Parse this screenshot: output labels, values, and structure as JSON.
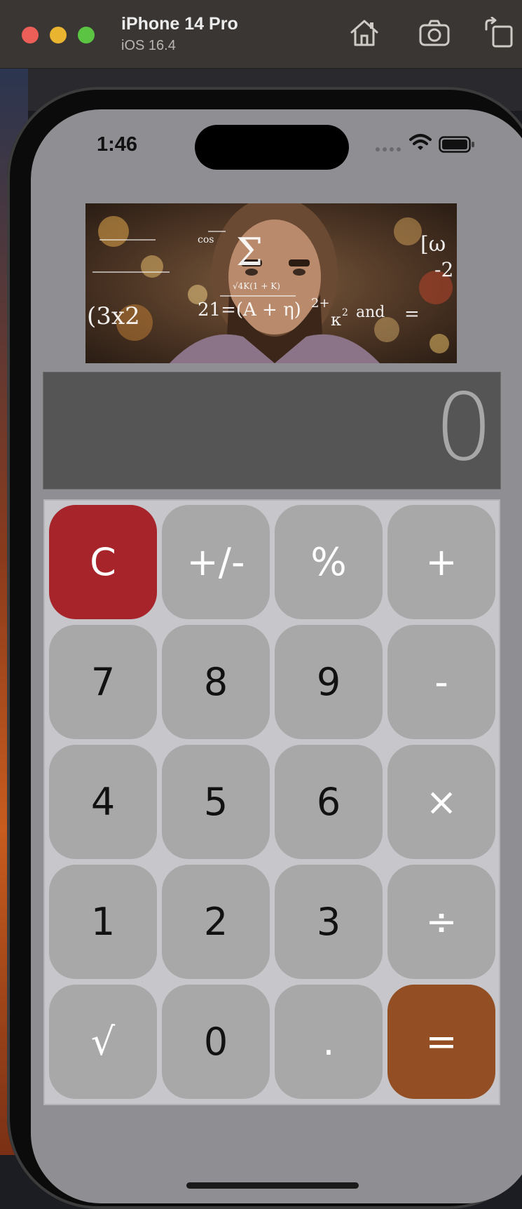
{
  "simulator": {
    "device_name": "iPhone 14 Pro",
    "os_version": "iOS 16.4",
    "icons": [
      "home-icon",
      "screenshot-camera-icon",
      "rotate-icon"
    ]
  },
  "status_bar": {
    "time": "1:46",
    "icons": [
      "signal-icon",
      "wifi-icon",
      "battery-icon"
    ]
  },
  "banner": {
    "formula_text": [
      "Σ",
      "cos",
      "(3x2",
      "21=(A + η)",
      "2+",
      "κ",
      "2",
      "and",
      "=",
      "[ω",
      "-2",
      "√4K(1 + K)"
    ]
  },
  "display": {
    "value": "0"
  },
  "keypad": {
    "rows": [
      [
        {
          "label": "C",
          "kind": "clear"
        },
        {
          "label": "+/-",
          "kind": "op"
        },
        {
          "label": "%",
          "kind": "op"
        },
        {
          "label": "+",
          "kind": "op"
        }
      ],
      [
        {
          "label": "7",
          "kind": "digit"
        },
        {
          "label": "8",
          "kind": "digit"
        },
        {
          "label": "9",
          "kind": "digit"
        },
        {
          "label": "-",
          "kind": "op"
        }
      ],
      [
        {
          "label": "4",
          "kind": "digit"
        },
        {
          "label": "5",
          "kind": "digit"
        },
        {
          "label": "6",
          "kind": "digit"
        },
        {
          "label": "×",
          "kind": "op"
        }
      ],
      [
        {
          "label": "1",
          "kind": "digit"
        },
        {
          "label": "2",
          "kind": "digit"
        },
        {
          "label": "3",
          "kind": "digit"
        },
        {
          "label": "÷",
          "kind": "op"
        }
      ],
      [
        {
          "label": "√",
          "kind": "op"
        },
        {
          "label": "0",
          "kind": "digit"
        },
        {
          "label": ".",
          "kind": "op"
        },
        {
          "label": "=",
          "kind": "equals"
        }
      ]
    ]
  },
  "colors": {
    "screen_bg": "#8f8e93",
    "display_bg": "#555555",
    "display_text": "#a7a7a7",
    "keypad_bg": "#c7c6cb",
    "key_bg": "#a8a8a8",
    "clear_key": "#a8242b",
    "equals_key": "#934f23"
  }
}
